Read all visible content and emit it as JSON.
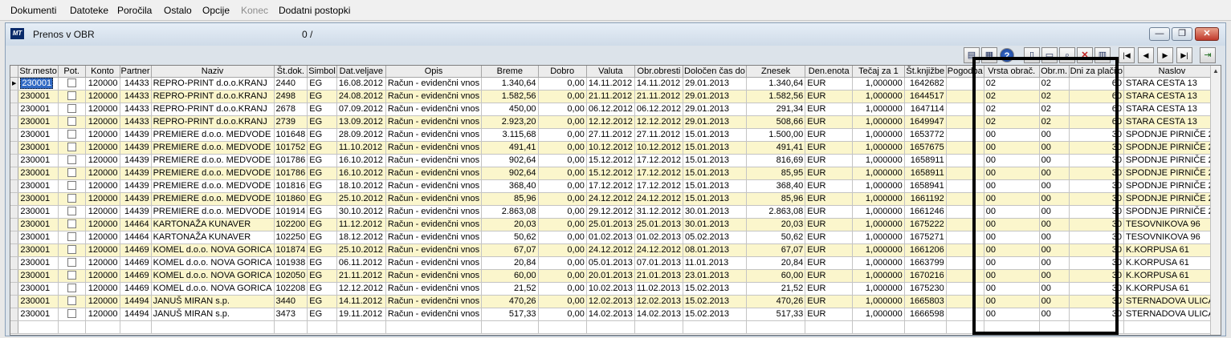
{
  "menu": {
    "items": [
      {
        "label": "Dokumenti",
        "disabled": false
      },
      {
        "label": "Datoteke",
        "disabled": false
      },
      {
        "label": "Poročila",
        "disabled": false
      },
      {
        "label": "Ostalo",
        "disabled": false
      },
      {
        "label": "Opcije",
        "disabled": false
      },
      {
        "label": "Konec",
        "disabled": true
      },
      {
        "label": "Dodatni postopki",
        "disabled": false
      }
    ]
  },
  "window": {
    "icon_text": "MT",
    "title": "Prenos v OBR",
    "counter": "0 /",
    "minimize_label": "—",
    "restore_label": "❐",
    "close_label": "✕"
  },
  "toolbar": {
    "icons": [
      {
        "name": "report-icon",
        "glyph": "▤"
      },
      {
        "name": "grid-view-icon",
        "glyph": "▦"
      },
      {
        "name": "help-icon",
        "glyph": "?"
      },
      {
        "name": "new-document-icon",
        "glyph": "▯"
      },
      {
        "name": "open-folder-icon",
        "glyph": "▭"
      },
      {
        "name": "search-icon",
        "glyph": "⌕"
      },
      {
        "name": "delete-icon",
        "glyph": "✕"
      },
      {
        "name": "print-icon",
        "glyph": "▥"
      },
      {
        "name": "first-record-icon",
        "glyph": "|◀"
      },
      {
        "name": "previous-record-icon",
        "glyph": "◀"
      },
      {
        "name": "next-record-icon",
        "glyph": "▶"
      },
      {
        "name": "last-record-icon",
        "glyph": "▶|"
      },
      {
        "name": "exit-icon",
        "glyph": "⇥"
      }
    ]
  },
  "grid": {
    "columns": [
      "Str.mesto",
      "Pot.",
      "Konto",
      "Partner",
      "Naziv",
      "Št.dok.",
      "Simbol",
      "Dat.veljave",
      "Opis",
      "Breme",
      "Dobro",
      "Valuta",
      "Obr.obresti",
      "Določen čas do",
      "Znesek",
      "Den.enota",
      "Tečaj za 1",
      "Št.knjižbe",
      "Pogodba",
      "Vrsta obrač.",
      "Obr.m.",
      "Dni za plačilo",
      "Naslov"
    ],
    "rows": [
      [
        "230001",
        "",
        "120000",
        "14433",
        "REPRO-PRINT d.o.o.KRANJ",
        "2440",
        "EG",
        "16.08.2012",
        "Račun - evidenčni vnos",
        "1.340,64",
        "0,00",
        "14.11.2012",
        "14.11.2012",
        "29.01.2013",
        "1.340,64",
        "EUR",
        "1,000000",
        "1642682",
        "",
        "02",
        "02",
        "60",
        "STARA CESTA 13"
      ],
      [
        "230001",
        "",
        "120000",
        "14433",
        "REPRO-PRINT d.o.o.KRANJ",
        "2498",
        "EG",
        "24.08.2012",
        "Račun - evidenčni vnos",
        "1.582,56",
        "0,00",
        "21.11.2012",
        "21.11.2012",
        "29.01.2013",
        "1.582,56",
        "EUR",
        "1,000000",
        "1644517",
        "",
        "02",
        "02",
        "60",
        "STARA CESTA 13"
      ],
      [
        "230001",
        "",
        "120000",
        "14433",
        "REPRO-PRINT d.o.o.KRANJ",
        "2678",
        "EG",
        "07.09.2012",
        "Račun - evidenčni vnos",
        "450,00",
        "0,00",
        "06.12.2012",
        "06.12.2012",
        "29.01.2013",
        "291,34",
        "EUR",
        "1,000000",
        "1647114",
        "",
        "02",
        "02",
        "60",
        "STARA CESTA 13"
      ],
      [
        "230001",
        "",
        "120000",
        "14433",
        "REPRO-PRINT d.o.o.KRANJ",
        "2739",
        "EG",
        "13.09.2012",
        "Račun - evidenčni vnos",
        "2.923,20",
        "0,00",
        "12.12.2012",
        "12.12.2012",
        "29.01.2013",
        "508,66",
        "EUR",
        "1,000000",
        "1649947",
        "",
        "02",
        "02",
        "60",
        "STARA CESTA 13"
      ],
      [
        "230001",
        "",
        "120000",
        "14439",
        "PREMIERE d.o.o. MEDVODE",
        "101648",
        "EG",
        "28.09.2012",
        "Račun - evidenčni vnos",
        "3.115,68",
        "0,00",
        "27.11.2012",
        "27.11.2012",
        "15.01.2013",
        "1.500,00",
        "EUR",
        "1,000000",
        "1653772",
        "",
        "00",
        "00",
        "30",
        "SPODNJE PIRNIČE 22"
      ],
      [
        "230001",
        "",
        "120000",
        "14439",
        "PREMIERE d.o.o. MEDVODE",
        "101752",
        "EG",
        "11.10.2012",
        "Račun - evidenčni vnos",
        "491,41",
        "0,00",
        "10.12.2012",
        "10.12.2012",
        "15.01.2013",
        "491,41",
        "EUR",
        "1,000000",
        "1657675",
        "",
        "00",
        "00",
        "30",
        "SPODNJE PIRNIČE 22"
      ],
      [
        "230001",
        "",
        "120000",
        "14439",
        "PREMIERE d.o.o. MEDVODE",
        "101786",
        "EG",
        "16.10.2012",
        "Račun - evidenčni vnos",
        "902,64",
        "0,00",
        "15.12.2012",
        "17.12.2012",
        "15.01.2013",
        "816,69",
        "EUR",
        "1,000000",
        "1658911",
        "",
        "00",
        "00",
        "30",
        "SPODNJE PIRNIČE 22"
      ],
      [
        "230001",
        "",
        "120000",
        "14439",
        "PREMIERE d.o.o. MEDVODE",
        "101786",
        "EG",
        "16.10.2012",
        "Račun - evidenčni vnos",
        "902,64",
        "0,00",
        "15.12.2012",
        "17.12.2012",
        "15.01.2013",
        "85,95",
        "EUR",
        "1,000000",
        "1658911",
        "",
        "00",
        "00",
        "30",
        "SPODNJE PIRNIČE 22"
      ],
      [
        "230001",
        "",
        "120000",
        "14439",
        "PREMIERE d.o.o. MEDVODE",
        "101816",
        "EG",
        "18.10.2012",
        "Račun - evidenčni vnos",
        "368,40",
        "0,00",
        "17.12.2012",
        "17.12.2012",
        "15.01.2013",
        "368,40",
        "EUR",
        "1,000000",
        "1658941",
        "",
        "00",
        "00",
        "30",
        "SPODNJE PIRNIČE 22"
      ],
      [
        "230001",
        "",
        "120000",
        "14439",
        "PREMIERE d.o.o. MEDVODE",
        "101860",
        "EG",
        "25.10.2012",
        "Račun - evidenčni vnos",
        "85,96",
        "0,00",
        "24.12.2012",
        "24.12.2012",
        "15.01.2013",
        "85,96",
        "EUR",
        "1,000000",
        "1661192",
        "",
        "00",
        "00",
        "30",
        "SPODNJE PIRNIČE 22"
      ],
      [
        "230001",
        "",
        "120000",
        "14439",
        "PREMIERE d.o.o. MEDVODE",
        "101914",
        "EG",
        "30.10.2012",
        "Račun - evidenčni vnos",
        "2.863,08",
        "0,00",
        "29.12.2012",
        "31.12.2012",
        "30.01.2013",
        "2.863,08",
        "EUR",
        "1,000000",
        "1661246",
        "",
        "00",
        "00",
        "30",
        "SPODNJE PIRNIČE 22"
      ],
      [
        "230001",
        "",
        "120000",
        "14464",
        "KARTONAŽA KUNAVER",
        "102200",
        "EG",
        "11.12.2012",
        "Račun - evidenčni vnos",
        "20,03",
        "0,00",
        "25.01.2013",
        "25.01.2013",
        "30.01.2013",
        "20,03",
        "EUR",
        "1,000000",
        "1675222",
        "",
        "00",
        "00",
        "30",
        "TESOVNIKOVA 96"
      ],
      [
        "230001",
        "",
        "120000",
        "14464",
        "KARTONAŽA KUNAVER",
        "102250",
        "EG",
        "18.12.2012",
        "Račun - evidenčni vnos",
        "50,62",
        "0,00",
        "01.02.2013",
        "01.02.2013",
        "05.02.2013",
        "50,62",
        "EUR",
        "1,000000",
        "1675271",
        "",
        "00",
        "00",
        "30",
        "TESOVNIKOVA 96"
      ],
      [
        "230001",
        "",
        "120000",
        "14469",
        "KOMEL d.o.o. NOVA GORICA",
        "101874",
        "EG",
        "25.10.2012",
        "Račun - evidenčni vnos",
        "67,07",
        "0,00",
        "24.12.2012",
        "24.12.2012",
        "08.01.2013",
        "67,07",
        "EUR",
        "1,000000",
        "1661206",
        "",
        "00",
        "00",
        "30",
        "K.KORPUSA 61"
      ],
      [
        "230001",
        "",
        "120000",
        "14469",
        "KOMEL d.o.o. NOVA GORICA",
        "101938",
        "EG",
        "06.11.2012",
        "Račun - evidenčni vnos",
        "20,84",
        "0,00",
        "05.01.2013",
        "07.01.2013",
        "11.01.2013",
        "20,84",
        "EUR",
        "1,000000",
        "1663799",
        "",
        "00",
        "00",
        "30",
        "K.KORPUSA 61"
      ],
      [
        "230001",
        "",
        "120000",
        "14469",
        "KOMEL d.o.o. NOVA GORICA",
        "102050",
        "EG",
        "21.11.2012",
        "Račun - evidenčni vnos",
        "60,00",
        "0,00",
        "20.01.2013",
        "21.01.2013",
        "23.01.2013",
        "60,00",
        "EUR",
        "1,000000",
        "1670216",
        "",
        "00",
        "00",
        "30",
        "K.KORPUSA 61"
      ],
      [
        "230001",
        "",
        "120000",
        "14469",
        "KOMEL d.o.o. NOVA GORICA",
        "102208",
        "EG",
        "12.12.2012",
        "Račun - evidenčni vnos",
        "21,52",
        "0,00",
        "10.02.2013",
        "11.02.2013",
        "15.02.2013",
        "21,52",
        "EUR",
        "1,000000",
        "1675230",
        "",
        "00",
        "00",
        "30",
        "K.KORPUSA 61"
      ],
      [
        "230001",
        "",
        "120000",
        "14494",
        "JANUŠ MIRAN s.p.",
        "3440",
        "EG",
        "14.11.2012",
        "Račun - evidenčni vnos",
        "470,26",
        "0,00",
        "12.02.2013",
        "12.02.2013",
        "15.02.2013",
        "470,26",
        "EUR",
        "1,000000",
        "1665803",
        "",
        "00",
        "00",
        "30",
        "STERNADOVA ULICA"
      ],
      [
        "230001",
        "",
        "120000",
        "14494",
        "JANUŠ MIRAN s.p.",
        "3473",
        "EG",
        "19.11.2012",
        "Račun - evidenčni vnos",
        "517,33",
        "0,00",
        "14.02.2013",
        "14.02.2013",
        "15.02.2013",
        "517,33",
        "EUR",
        "1,000000",
        "1666598",
        "",
        "00",
        "00",
        "30",
        "STERNADOVA ULICA"
      ]
    ]
  },
  "colors": {
    "row_even": "#fbf6cc",
    "row_odd": "#ffffff",
    "selection": "#316ac5",
    "highlight_box": "#000000"
  }
}
